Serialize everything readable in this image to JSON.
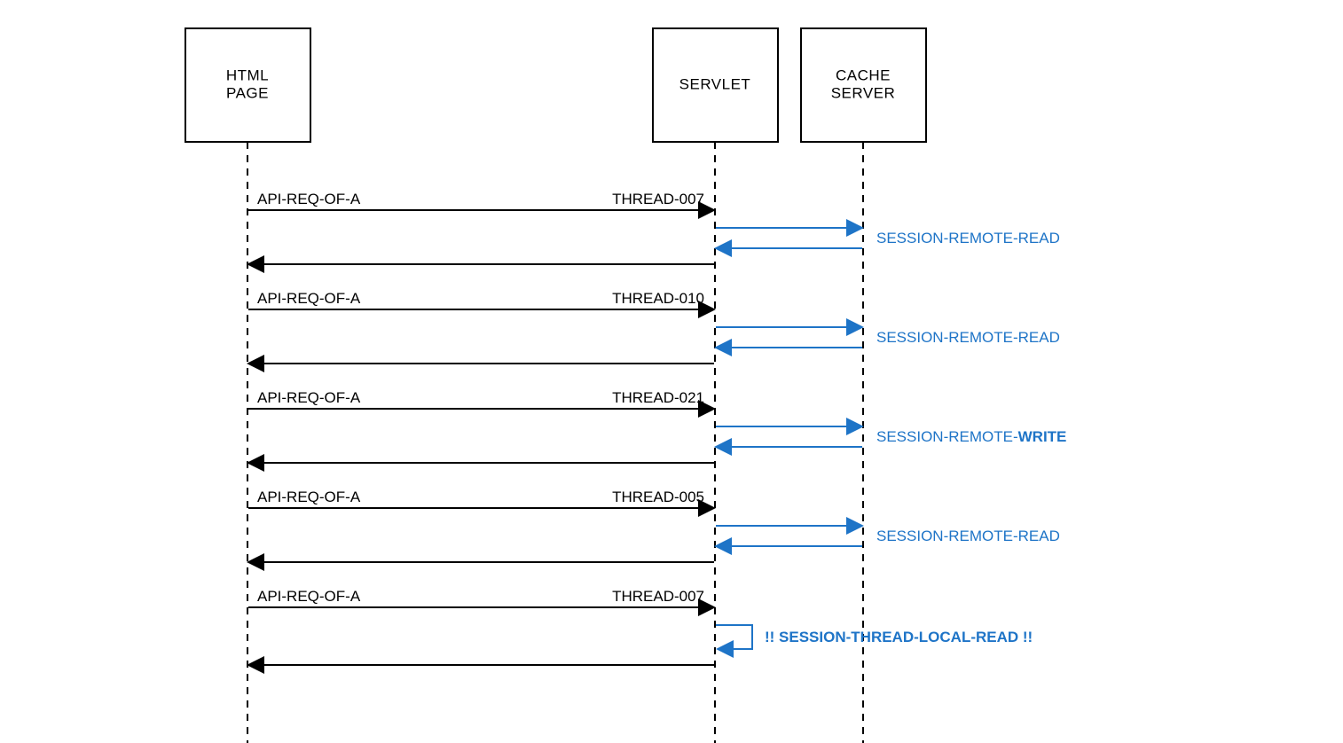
{
  "colors": {
    "accent": "#1e74c7",
    "foreground": "#000000",
    "background": "#ffffff"
  },
  "actors": {
    "html": {
      "line1": "HTML",
      "line2": "PAGE"
    },
    "servlet": {
      "line1": "SERVLET"
    },
    "cache": {
      "line1": "CACHE",
      "line2": "SERVER"
    }
  },
  "labels": {
    "api_req": "API-REQ-OF-A",
    "thread_007": "THREAD-007",
    "thread_010": "THREAD-010",
    "thread_021": "THREAD-021",
    "thread_005": "THREAD-005",
    "session_read_prefix": "SESSION-REMOTE-READ",
    "session_write_prefix": "SESSION-REMOTE-",
    "session_write_bold": "WRITE",
    "session_local": "!! SESSION-THREAD-LOCAL-READ !!"
  },
  "chart_data": {
    "type": "sequence-diagram",
    "participants": [
      "HTML PAGE",
      "SERVLET",
      "CACHE SERVER"
    ],
    "messages": [
      {
        "from": "HTML PAGE",
        "to": "SERVLET",
        "left_label": "API-REQ-OF-A",
        "right_label": "THREAD-007"
      },
      {
        "from": "SERVLET",
        "to": "CACHE SERVER",
        "label": "SESSION-REMOTE-READ",
        "color": "blue",
        "roundtrip": true
      },
      {
        "from": "SERVLET",
        "to": "HTML PAGE",
        "return": true
      },
      {
        "from": "HTML PAGE",
        "to": "SERVLET",
        "left_label": "API-REQ-OF-A",
        "right_label": "THREAD-010"
      },
      {
        "from": "SERVLET",
        "to": "CACHE SERVER",
        "label": "SESSION-REMOTE-READ",
        "color": "blue",
        "roundtrip": true
      },
      {
        "from": "SERVLET",
        "to": "HTML PAGE",
        "return": true
      },
      {
        "from": "HTML PAGE",
        "to": "SERVLET",
        "left_label": "API-REQ-OF-A",
        "right_label": "THREAD-021"
      },
      {
        "from": "SERVLET",
        "to": "CACHE SERVER",
        "label": "SESSION-REMOTE-WRITE",
        "color": "blue",
        "roundtrip": true,
        "emphasis": "WRITE"
      },
      {
        "from": "SERVLET",
        "to": "HTML PAGE",
        "return": true
      },
      {
        "from": "HTML PAGE",
        "to": "SERVLET",
        "left_label": "API-REQ-OF-A",
        "right_label": "THREAD-005"
      },
      {
        "from": "SERVLET",
        "to": "CACHE SERVER",
        "label": "SESSION-REMOTE-READ",
        "color": "blue",
        "roundtrip": true
      },
      {
        "from": "SERVLET",
        "to": "HTML PAGE",
        "return": true
      },
      {
        "from": "HTML PAGE",
        "to": "SERVLET",
        "left_label": "API-REQ-OF-A",
        "right_label": "THREAD-007"
      },
      {
        "from": "SERVLET",
        "to": "SERVLET",
        "label": "!! SESSION-THREAD-LOCAL-READ !!",
        "color": "blue",
        "self": true,
        "emphasis": "full"
      },
      {
        "from": "SERVLET",
        "to": "HTML PAGE",
        "return": true
      }
    ]
  }
}
